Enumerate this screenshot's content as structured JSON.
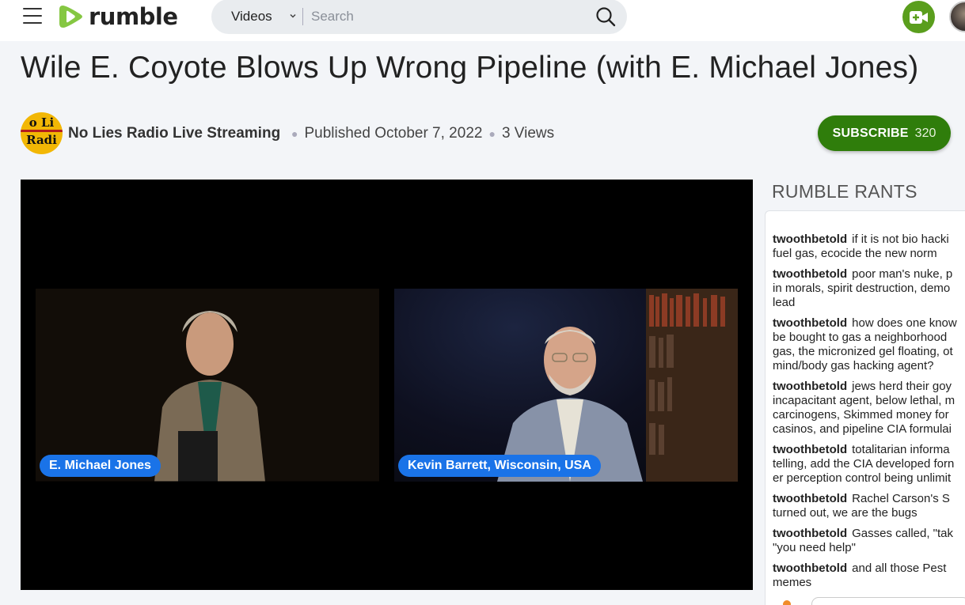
{
  "header": {
    "logo_text": "rumble",
    "search_category": "Videos",
    "search_placeholder": "Search",
    "search_value": ""
  },
  "video": {
    "title": "Wile E. Coyote Blows Up Wrong Pipeline (with E. Michael Jones)",
    "channel_name": "No Lies Radio Live Streaming",
    "channel_avatar_lines": [
      "o Li",
      "Radi"
    ],
    "published": "Published October 7, 2022",
    "views": "3 Views",
    "subscribe_label": "SUBSCRIBE",
    "subscriber_count": "320",
    "participants": [
      "E. Michael Jones",
      "Kevin Barrett, Wisconsin, USA"
    ]
  },
  "rants": {
    "title": "RUMBLE RANTS",
    "items": [
      {
        "user": "twoothbetold",
        "lines": [
          "if it is not bio hacki",
          "fuel gas, ecocide the new norm"
        ]
      },
      {
        "user": "twoothbetold",
        "lines": [
          "poor man's nuke, p",
          "in morals, spirit destruction, demo",
          "lead"
        ]
      },
      {
        "user": "twoothbetold",
        "lines": [
          "how does one know",
          "be bought to gas a neighborhood",
          "gas, the micronized gel floating, ot",
          "mind/body gas hacking agent?"
        ]
      },
      {
        "user": "twoothbetold",
        "lines": [
          "jews herd their goy",
          "incapacitant agent, below lethal, m",
          "carcinogens, Skimmed money for",
          "casinos, and pipeline CIA formulai"
        ]
      },
      {
        "user": "twoothbetold",
        "lines": [
          "totalitarian informa",
          "telling, add the CIA developed forn",
          "er perception control being unlimit"
        ]
      },
      {
        "user": "twoothbetold",
        "lines": [
          "Rachel Carson's S",
          "turned out, we are the bugs"
        ]
      },
      {
        "user": "twoothbetold",
        "lines": [
          "Gasses called, \"tak",
          "\"you need help\""
        ]
      },
      {
        "user": "twoothbetold",
        "lines": [
          "and all those Pest",
          "memes"
        ]
      }
    ]
  },
  "colors": {
    "brand_green": "#85c742",
    "subscribe_green": "#2f7d0b",
    "name_tag_blue": "#1a73e8"
  },
  "icons": {
    "menu": "hamburger-menu-icon",
    "search": "search-icon",
    "upload": "video-upload-icon",
    "chevron": "chevron-down-icon"
  }
}
